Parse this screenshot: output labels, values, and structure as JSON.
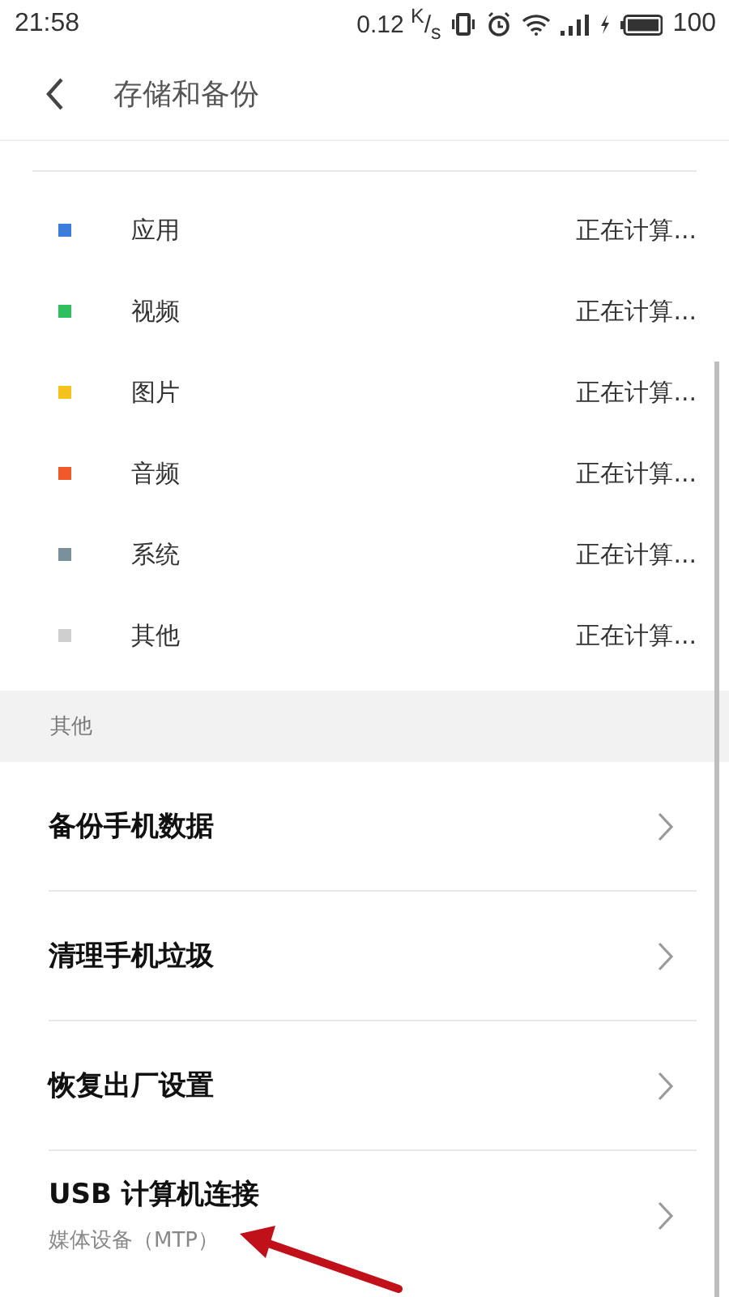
{
  "status_bar": {
    "time": "21:58",
    "speed": "0.12 $^{K}$/$_{s}$",
    "battery": "100"
  },
  "header": {
    "title": "存储和备份"
  },
  "storage": [
    {
      "label": "应用",
      "value": "正在计算...",
      "color": "#3b7ddd"
    },
    {
      "label": "视频",
      "value": "正在计算...",
      "color": "#2fbf5c"
    },
    {
      "label": "图片",
      "value": "正在计算...",
      "color": "#f5c11b"
    },
    {
      "label": "音频",
      "value": "正在计算...",
      "color": "#f0592a"
    },
    {
      "label": "系统",
      "value": "正在计算...",
      "color": "#7a909c"
    },
    {
      "label": "其他",
      "value": "正在计算...",
      "color": "#cfcfcf"
    }
  ],
  "section": {
    "title": "其他"
  },
  "items": [
    {
      "label": "备份手机数据"
    },
    {
      "label": "清理手机垃圾"
    },
    {
      "label": "恢复出厂设置"
    },
    {
      "label": "USB 计算机连接",
      "subtitle": "媒体设备（MTP）"
    }
  ]
}
